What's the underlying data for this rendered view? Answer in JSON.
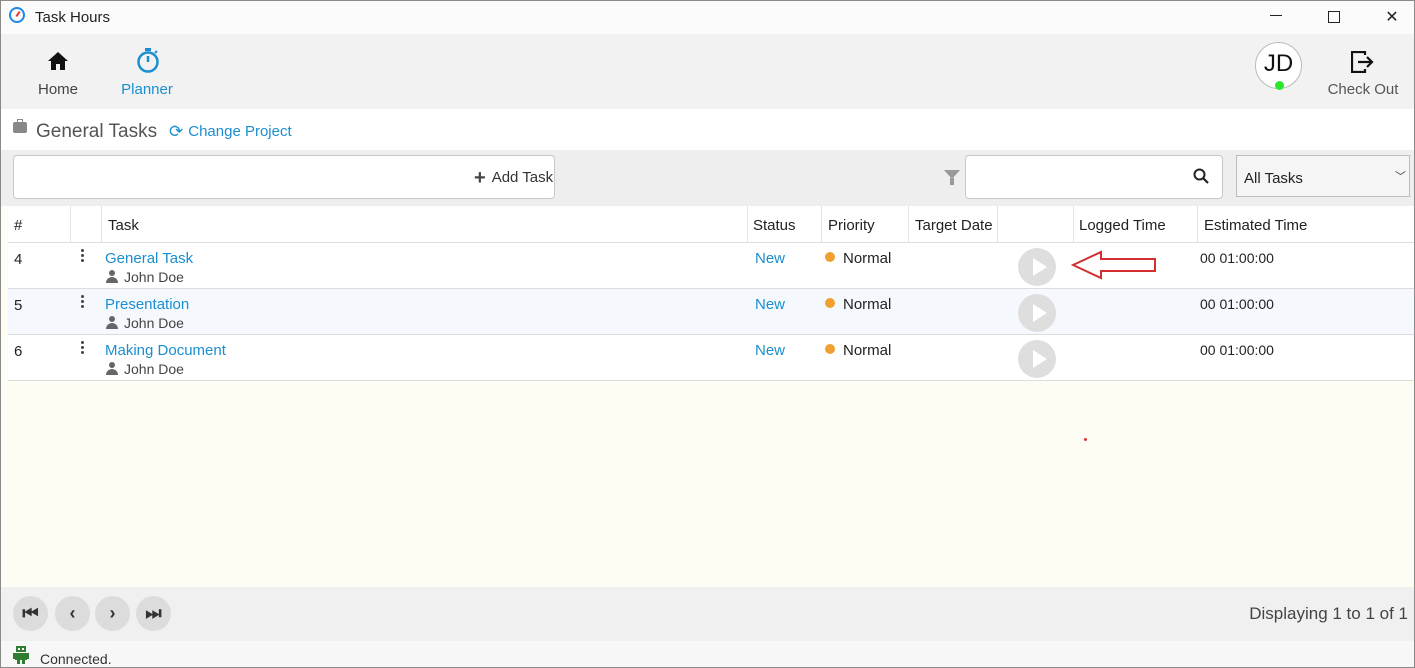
{
  "window": {
    "title": "Task Hours"
  },
  "nav": {
    "home": "Home",
    "planner": "Planner",
    "avatar_initials": "JD",
    "checkout": "Check Out"
  },
  "project": {
    "title": "General Tasks",
    "change_label": "Change Project"
  },
  "toolbar": {
    "add_task_label": "Add Task",
    "filter_select": "All Tasks"
  },
  "table": {
    "headers": [
      "#",
      "Task",
      "Status",
      "Priority",
      "Target Date",
      "Logged Time",
      "Estimated Time"
    ],
    "rows": [
      {
        "num": "4",
        "task": "General Task",
        "assignee": "John Doe",
        "status": "New",
        "priority": "Normal",
        "target_date": "",
        "logged": "",
        "estimated": "00 01:00:00"
      },
      {
        "num": "5",
        "task": "Presentation",
        "assignee": "John Doe",
        "status": "New",
        "priority": "Normal",
        "target_date": "",
        "logged": "",
        "estimated": "00 01:00:00"
      },
      {
        "num": "6",
        "task": "Making Document",
        "assignee": "John Doe",
        "status": "New",
        "priority": "Normal",
        "target_date": "",
        "logged": "",
        "estimated": "00 01:00:00"
      }
    ]
  },
  "pager": {
    "displaying": "Displaying 1 to 1 of 1"
  },
  "statusbar": {
    "connection": "Connected."
  },
  "colors": {
    "accent": "#1a8fd0",
    "priority_normal": "#f0a030",
    "online": "#2ee52e",
    "annotation": "#d32f2f"
  }
}
